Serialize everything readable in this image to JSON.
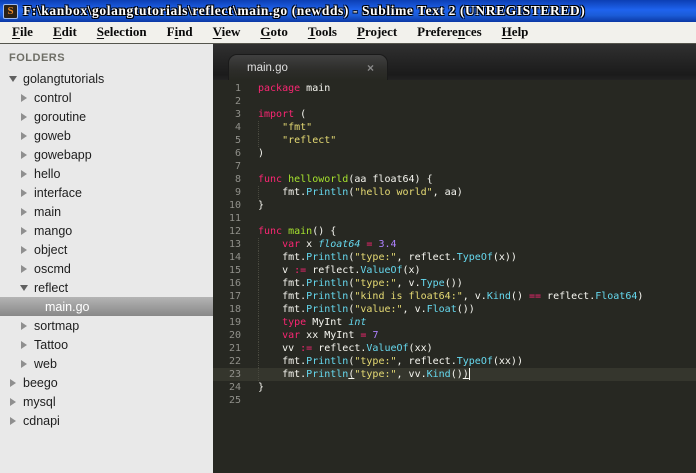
{
  "window": {
    "title": "F:\\kanbox\\golangtutorials\\reflect\\main.go (newdds) - Sublime Text 2 (UNREGISTERED)",
    "app_icon": "sublime-text-icon",
    "app_icon_letter": "S"
  },
  "menu": {
    "items": [
      {
        "label": "File",
        "mnemonic_index": 0
      },
      {
        "label": "Edit",
        "mnemonic_index": 0
      },
      {
        "label": "Selection",
        "mnemonic_index": 0
      },
      {
        "label": "Find",
        "mnemonic_index": 1
      },
      {
        "label": "View",
        "mnemonic_index": 0
      },
      {
        "label": "Goto",
        "mnemonic_index": 0
      },
      {
        "label": "Tools",
        "mnemonic_index": 0
      },
      {
        "label": "Project",
        "mnemonic_index": 0
      },
      {
        "label": "Preferences",
        "mnemonic_index": 7
      },
      {
        "label": "Help",
        "mnemonic_index": 0
      }
    ]
  },
  "sidebar": {
    "header": "FOLDERS",
    "items": [
      {
        "label": "golangtutorials",
        "level": 0,
        "state": "expanded",
        "selected": false
      },
      {
        "label": "control",
        "level": 1,
        "state": "collapsed",
        "selected": false
      },
      {
        "label": "goroutine",
        "level": 1,
        "state": "collapsed",
        "selected": false
      },
      {
        "label": "goweb",
        "level": 1,
        "state": "collapsed",
        "selected": false
      },
      {
        "label": "gowebapp",
        "level": 1,
        "state": "collapsed",
        "selected": false
      },
      {
        "label": "hello",
        "level": 1,
        "state": "collapsed",
        "selected": false
      },
      {
        "label": "interface",
        "level": 1,
        "state": "collapsed",
        "selected": false
      },
      {
        "label": "main",
        "level": 1,
        "state": "collapsed",
        "selected": false
      },
      {
        "label": "mango",
        "level": 1,
        "state": "collapsed",
        "selected": false
      },
      {
        "label": "object",
        "level": 1,
        "state": "collapsed",
        "selected": false
      },
      {
        "label": "oscmd",
        "level": 1,
        "state": "collapsed",
        "selected": false
      },
      {
        "label": "reflect",
        "level": 1,
        "state": "expanded",
        "selected": false
      },
      {
        "label": "main.go",
        "level": 2,
        "state": "file",
        "selected": true
      },
      {
        "label": "sortmap",
        "level": 1,
        "state": "collapsed",
        "selected": false
      },
      {
        "label": "Tattoo",
        "level": 1,
        "state": "collapsed",
        "selected": false
      },
      {
        "label": "web",
        "level": 1,
        "state": "collapsed",
        "selected": false
      },
      {
        "label": "beego",
        "level": 0,
        "state": "collapsed",
        "selected": false
      },
      {
        "label": "mysql",
        "level": 0,
        "state": "collapsed",
        "selected": false
      },
      {
        "label": "cdnapi",
        "level": 0,
        "state": "collapsed",
        "selected": false
      }
    ]
  },
  "tabbar": {
    "tabs": [
      {
        "label": "main.go",
        "close_glyph": "×",
        "active": true
      }
    ]
  },
  "editor": {
    "language": "Go",
    "cursor_line": 23,
    "line_count": 25,
    "colors": {
      "background": "#272822",
      "foreground": "#f8f8f2",
      "keyword": "#f92672",
      "string": "#e6db74",
      "support_function": "#66d9ef",
      "type": "#66d9ef",
      "number": "#ae81ff",
      "function_name": "#a6e22e",
      "line_number": "#90908a",
      "current_line": "#35362d",
      "titlebar": "#1b5cd7",
      "sidebar_background": "#e9e9e9"
    },
    "lines": [
      {
        "n": 1,
        "t": [
          [
            "k",
            "package"
          ],
          [
            "p",
            " main"
          ]
        ]
      },
      {
        "n": 2,
        "t": []
      },
      {
        "n": 3,
        "t": [
          [
            "k",
            "import"
          ],
          [
            "p",
            " ("
          ]
        ]
      },
      {
        "n": 4,
        "t": [
          [
            "p",
            "    "
          ],
          [
            "s",
            "\"fmt\""
          ]
        ]
      },
      {
        "n": 5,
        "t": [
          [
            "p",
            "    "
          ],
          [
            "s",
            "\"reflect\""
          ]
        ]
      },
      {
        "n": 6,
        "t": [
          [
            "p",
            ")"
          ]
        ]
      },
      {
        "n": 7,
        "t": []
      },
      {
        "n": 8,
        "t": [
          [
            "k",
            "func "
          ],
          [
            "g",
            "helloworld"
          ],
          [
            "p",
            "(aa float64) {"
          ]
        ]
      },
      {
        "n": 9,
        "t": [
          [
            "p",
            "    fmt."
          ],
          [
            "f",
            "Println"
          ],
          [
            "p",
            "("
          ],
          [
            "s",
            "\"hello world\""
          ],
          [
            "p",
            ", aa)"
          ]
        ]
      },
      {
        "n": 10,
        "t": [
          [
            "p",
            "}"
          ]
        ]
      },
      {
        "n": 11,
        "t": []
      },
      {
        "n": 12,
        "t": [
          [
            "k",
            "func "
          ],
          [
            "g",
            "main"
          ],
          [
            "p",
            "() {"
          ]
        ]
      },
      {
        "n": 13,
        "t": [
          [
            "p",
            "    "
          ],
          [
            "k",
            "var"
          ],
          [
            "p",
            " x "
          ],
          [
            "t",
            "float64"
          ],
          [
            "p",
            " "
          ],
          [
            "k",
            "="
          ],
          [
            "p",
            " "
          ],
          [
            "n",
            "3.4"
          ]
        ]
      },
      {
        "n": 14,
        "t": [
          [
            "p",
            "    fmt."
          ],
          [
            "f",
            "Println"
          ],
          [
            "p",
            "("
          ],
          [
            "s",
            "\"type:\""
          ],
          [
            "p",
            ", reflect."
          ],
          [
            "f",
            "TypeOf"
          ],
          [
            "p",
            "(x))"
          ]
        ]
      },
      {
        "n": 15,
        "t": [
          [
            "p",
            "    v "
          ],
          [
            "k",
            ":="
          ],
          [
            "p",
            " reflect."
          ],
          [
            "f",
            "ValueOf"
          ],
          [
            "p",
            "(x)"
          ]
        ]
      },
      {
        "n": 16,
        "t": [
          [
            "p",
            "    fmt."
          ],
          [
            "f",
            "Println"
          ],
          [
            "p",
            "("
          ],
          [
            "s",
            "\"type:\""
          ],
          [
            "p",
            ", v."
          ],
          [
            "f",
            "Type"
          ],
          [
            "p",
            "())"
          ]
        ]
      },
      {
        "n": 17,
        "t": [
          [
            "p",
            "    fmt."
          ],
          [
            "f",
            "Println"
          ],
          [
            "p",
            "("
          ],
          [
            "s",
            "\"kind is float64:\""
          ],
          [
            "p",
            ", v."
          ],
          [
            "f",
            "Kind"
          ],
          [
            "p",
            "() "
          ],
          [
            "k",
            "=="
          ],
          [
            "p",
            " reflect."
          ],
          [
            "f",
            "Float64"
          ],
          [
            "p",
            ")"
          ]
        ]
      },
      {
        "n": 18,
        "t": [
          [
            "p",
            "    fmt."
          ],
          [
            "f",
            "Println"
          ],
          [
            "p",
            "("
          ],
          [
            "s",
            "\"value:\""
          ],
          [
            "p",
            ", v."
          ],
          [
            "f",
            "Float"
          ],
          [
            "p",
            "())"
          ]
        ]
      },
      {
        "n": 19,
        "t": [
          [
            "p",
            "    "
          ],
          [
            "k",
            "type"
          ],
          [
            "p",
            " MyInt "
          ],
          [
            "t",
            "int"
          ]
        ]
      },
      {
        "n": 20,
        "t": [
          [
            "p",
            "    "
          ],
          [
            "k",
            "var"
          ],
          [
            "p",
            " xx MyInt "
          ],
          [
            "k",
            "="
          ],
          [
            "p",
            " "
          ],
          [
            "n",
            "7"
          ]
        ]
      },
      {
        "n": 21,
        "t": [
          [
            "p",
            "    vv "
          ],
          [
            "k",
            ":="
          ],
          [
            "p",
            " reflect."
          ],
          [
            "f",
            "ValueOf"
          ],
          [
            "p",
            "(xx)"
          ]
        ]
      },
      {
        "n": 22,
        "t": [
          [
            "p",
            "    fmt."
          ],
          [
            "f",
            "Println"
          ],
          [
            "p",
            "("
          ],
          [
            "s",
            "\"type:\""
          ],
          [
            "p",
            ", reflect."
          ],
          [
            "f",
            "TypeOf"
          ],
          [
            "p",
            "(xx))"
          ]
        ]
      },
      {
        "n": 23,
        "t": [
          [
            "p",
            "    fmt."
          ],
          [
            "f",
            "Println"
          ],
          [
            "u",
            "("
          ],
          [
            "s",
            "\"type:\""
          ],
          [
            "p",
            ", vv."
          ],
          [
            "f",
            "Kind"
          ],
          [
            "p",
            "()"
          ],
          [
            "u",
            ")"
          ]
        ]
      },
      {
        "n": 24,
        "t": [
          [
            "p",
            "}"
          ]
        ]
      },
      {
        "n": 25,
        "t": []
      }
    ]
  }
}
